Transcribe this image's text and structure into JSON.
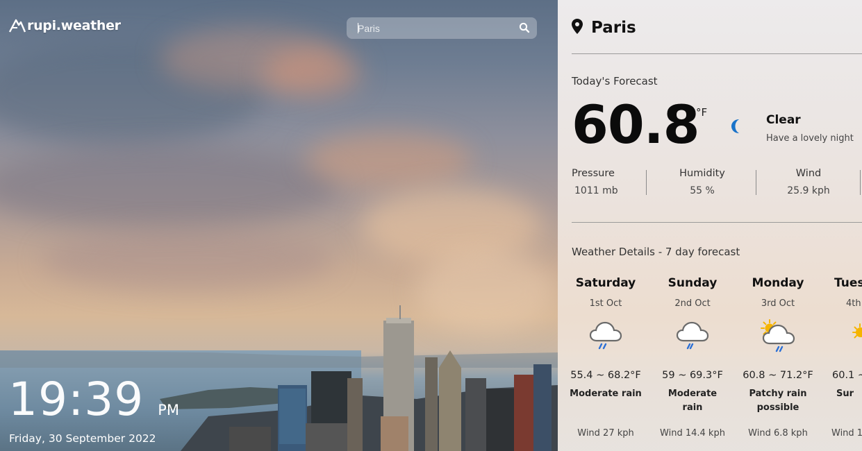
{
  "app": {
    "logo_text": "rupi.weather",
    "logo_icon": "mountain-logo-icon"
  },
  "search": {
    "value": "Paris",
    "placeholder": "Paris",
    "icon": "search-icon"
  },
  "clock": {
    "time": "19:39",
    "ampm": "PM",
    "date": "Friday, 30 September 2022"
  },
  "location": {
    "icon": "map-pin-icon",
    "city": "Paris"
  },
  "today": {
    "heading": "Today's Forecast",
    "temperature": "60.8",
    "unit": "°F",
    "icon": "moon-icon",
    "condition": "Clear",
    "message": "Have a lovely night",
    "stats": [
      {
        "label": "Pressure",
        "value": "1011 mb"
      },
      {
        "label": "Humidity",
        "value": "55 %"
      },
      {
        "label": "Wind",
        "value": "25.9 kph"
      }
    ]
  },
  "forecast": {
    "heading": "Weather Details - 7 day forecast",
    "days": [
      {
        "name": "Saturday",
        "date": "1st Oct",
        "icon": "rain-cloud-icon",
        "range": "55.4 ~ 68.2°F",
        "desc": "Moderate rain",
        "wind": "Wind 27 kph"
      },
      {
        "name": "Sunday",
        "date": "2nd Oct",
        "icon": "rain-cloud-icon",
        "range": "59 ~ 69.3°F",
        "desc": "Moderate rain",
        "wind": "Wind 14.4 kph"
      },
      {
        "name": "Monday",
        "date": "3rd Oct",
        "icon": "sun-rain-cloud-icon",
        "range": "60.8 ~ 71.2°F",
        "desc": "Patchy rain possible",
        "wind": "Wind 6.8 kph"
      },
      {
        "name": "Tues",
        "date": "4th",
        "icon": "sun-icon",
        "range": "60.1 ~",
        "desc": "Sur",
        "wind": "Wind 1"
      }
    ]
  },
  "colors": {
    "accent_moon": "#1a73c9",
    "rain_drop": "#2a6fd6",
    "sun": "#f5b400"
  }
}
